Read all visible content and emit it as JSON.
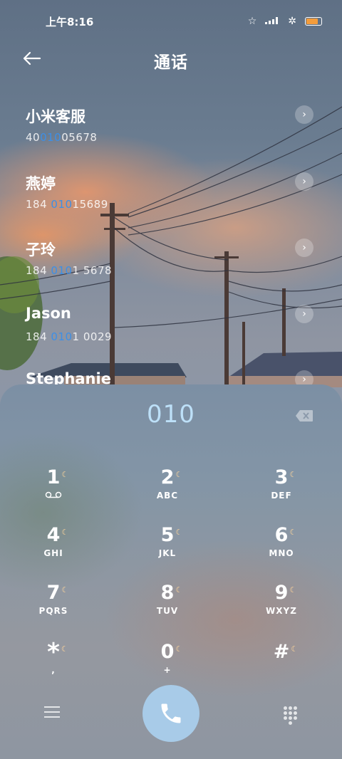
{
  "status_bar": {
    "time": "上午8:16"
  },
  "header": {
    "title": "通话"
  },
  "contacts": [
    {
      "name": "小米客服",
      "num_pre": "40",
      "num_hl": "010",
      "num_post": "05678"
    },
    {
      "name": "燕婷",
      "num_pre": "184 ",
      "num_hl": "010",
      "num_post": "15689"
    },
    {
      "name": "子玲",
      "num_pre": "184 ",
      "num_hl": "010",
      "num_post": "1 5678"
    },
    {
      "name": "Jason",
      "num_pre": "184 ",
      "num_hl": "010",
      "num_post": "1 0029"
    },
    {
      "name": "Stephanie",
      "num_pre": "",
      "num_hl": "",
      "num_post": ""
    }
  ],
  "dialer": {
    "entered": "010",
    "keys": [
      {
        "digit": "1",
        "letters": ""
      },
      {
        "digit": "2",
        "letters": "ABC"
      },
      {
        "digit": "3",
        "letters": "DEF"
      },
      {
        "digit": "4",
        "letters": "GHI"
      },
      {
        "digit": "5",
        "letters": "JKL"
      },
      {
        "digit": "6",
        "letters": "MNO"
      },
      {
        "digit": "7",
        "letters": "PQRS"
      },
      {
        "digit": "8",
        "letters": "TUV"
      },
      {
        "digit": "9",
        "letters": "WXYZ"
      },
      {
        "digit": "*",
        "letters": ","
      },
      {
        "digit": "0",
        "letters": "+"
      },
      {
        "digit": "#",
        "letters": ""
      }
    ]
  },
  "icons": {
    "back": "back-arrow-icon",
    "delete": "backspace-icon",
    "menu": "menu-icon",
    "call": "phone-icon",
    "keypad": "keypad-icon",
    "voicemail": "voicemail-icon"
  },
  "colors": {
    "highlight": "#3d8fe6",
    "entered_text": "#bde0f8",
    "call_button": "#a8cbe8"
  }
}
